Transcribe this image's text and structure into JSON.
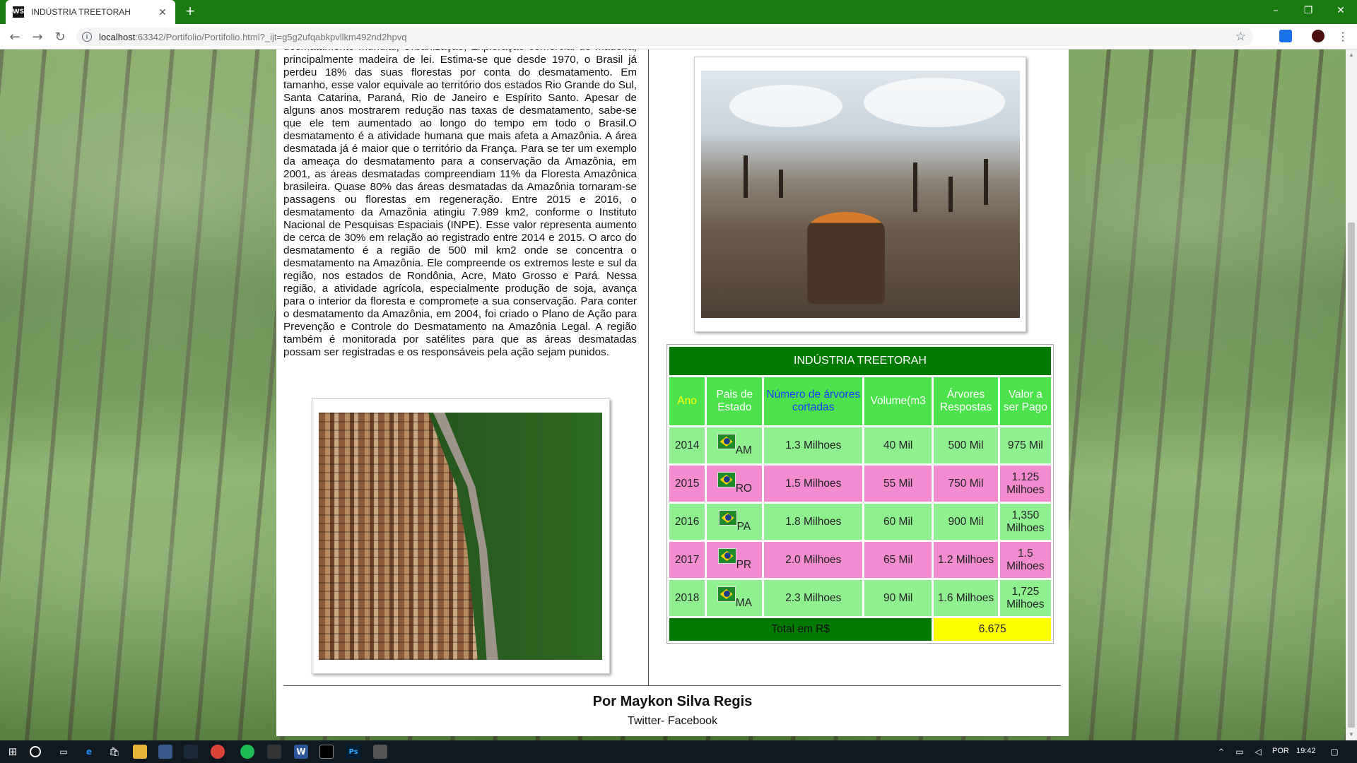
{
  "browser": {
    "tab_title": "INDÚSTRIA TREETORAH",
    "favicon_text": "WS",
    "url_host": "localhost",
    "url_rest": ":63342/Portifolio/Portifolio.html?_ijt=g5g2ufqabkpvllkm492nd2hpvq"
  },
  "article": {
    "text": "desmatamento mundial, Urbanização, Exploração comercial de madeira, principalmente madeira de lei. Estima-se que desde 1970, o Brasil já perdeu 18% das suas florestas por conta do desmatamento. Em tamanho, esse valor equivale ao território dos estados Rio Grande do Sul, Santa Catarina, Paraná, Rio de Janeiro e Espírito Santo. Apesar de alguns anos mostrarem redução nas taxas de desmatamento, sabe-se que ele tem aumentado ao longo do tempo em todo o Brasil.O desmatamento é a atividade humana que mais afeta a Amazônia. A área desmatada já é maior que o território da França. Para se ter um exemplo da ameaça do desmatamento para a conservação da Amazônia, em 2001, as áreas desmatadas compreendiam 11% da Floresta Amazônica brasileira. Quase 80% das áreas desmatadas da Amazônia tornaram-se passagens ou florestas em regeneração. Entre 2015 e 2016, o desmatamento da Amazônia atingiu 7.989 km2, conforme o Instituto Nacional de Pesquisas Espaciais (INPE). Esse valor representa aumento de cerca de 30% em relação ao registrado entre 2014 e 2015. O arco do desmatamento é a região de 500 mil km2 onde se concentra o desmatamento na Amazônia. Ele compreende os extremos leste e sul da região, nos estados de Rondônia, Acre, Mato Grosso e Pará. Nessa região, a atividade agrícola, especialmente produção de soja, avança para o interior da floresta e compromete a sua conservação. Para conter o desmatamento da Amazônia, em 2004, foi criado o Plano de Ação para Prevenção e Controle do Desmatamento na Amazônia Legal. A região também é monitorada por satélites para que as áreas desmatadas possam ser registradas e os responsáveis pela ação sejam punidos."
  },
  "table": {
    "title": "INDÚSTRIA TREETORAH",
    "headers": {
      "ano": "Ano",
      "pais": "Pais de Estado",
      "numero": "Número de árvores cortadas",
      "volume": "Volume(m3",
      "arvores": "Árvores Respostas",
      "valor": "Valor a ser Pago"
    },
    "rows": [
      {
        "ano": "2014",
        "uf": "AM",
        "numero": "1.3 Milhoes",
        "volume": "40 Mil",
        "arvores": "500 Mil",
        "valor": "975 Mil"
      },
      {
        "ano": "2015",
        "uf": "RO",
        "numero": "1.5 Milhoes",
        "volume": "55 Mil",
        "arvores": "750 Mil",
        "valor": "1.125 Milhoes"
      },
      {
        "ano": "2016",
        "uf": "PA",
        "numero": "1.8 Milhoes",
        "volume": "60 Mil",
        "arvores": "900 Mil",
        "valor": "1,350 Milhoes"
      },
      {
        "ano": "2017",
        "uf": "PR",
        "numero": "2.0 Milhoes",
        "volume": "65 Mil",
        "arvores": "1.2 Milhoes",
        "valor": "1.5 Milhoes"
      },
      {
        "ano": "2018",
        "uf": "MA",
        "numero": "2.3 Milhoes",
        "volume": "90 Mil",
        "arvores": "1.6 Milhoes",
        "valor": "1,725 Milhoes"
      }
    ],
    "total_label": "Total em R$",
    "total_value": "6.675"
  },
  "footer": {
    "author": "Por Maykon Silva Regis",
    "social": "Twitter- Facebook"
  },
  "taskbar": {
    "language": "POR",
    "time": "19:42"
  },
  "colors": {
    "tabbar": "#1b7a12",
    "table_title": "#007a00",
    "table_header": "#4ce24c",
    "row_green": "#90f090",
    "row_pink": "#f28bd0",
    "total": "#ffff00"
  }
}
